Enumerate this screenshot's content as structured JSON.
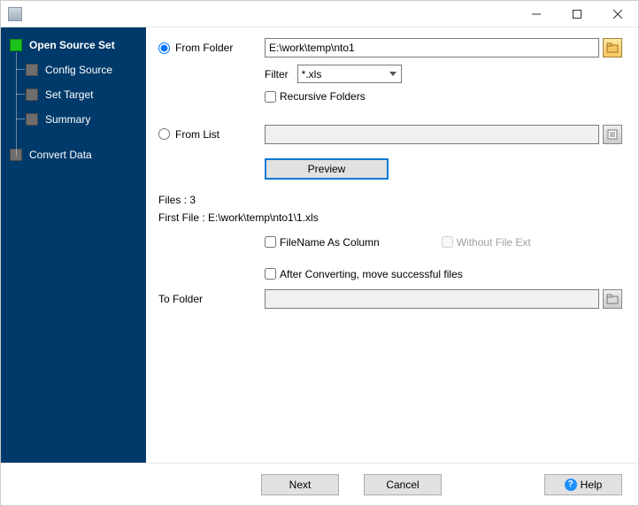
{
  "sidebar": {
    "items": [
      {
        "label": "Open Source Set"
      },
      {
        "label": "Config Source"
      },
      {
        "label": "Set Target"
      },
      {
        "label": "Summary"
      },
      {
        "label": "Convert Data"
      }
    ]
  },
  "form": {
    "from_folder_label": "From Folder",
    "from_folder_value": "E:\\work\\temp\\nto1",
    "filter_label": "Filter",
    "filter_value": "*.xls",
    "recursive_label": "Recursive Folders",
    "from_list_label": "From List",
    "from_list_value": "",
    "preview_label": "Preview",
    "files_count_label": "Files : 3",
    "first_file_label": "First File : E:\\work\\temp\\nto1\\1.xls",
    "filename_col_label": "FileName As Column",
    "without_ext_label": "Without File Ext",
    "after_convert_label": "After Converting, move successful files",
    "to_folder_label": "To Folder",
    "to_folder_value": ""
  },
  "footer": {
    "next": "Next",
    "cancel": "Cancel",
    "help": "Help"
  }
}
